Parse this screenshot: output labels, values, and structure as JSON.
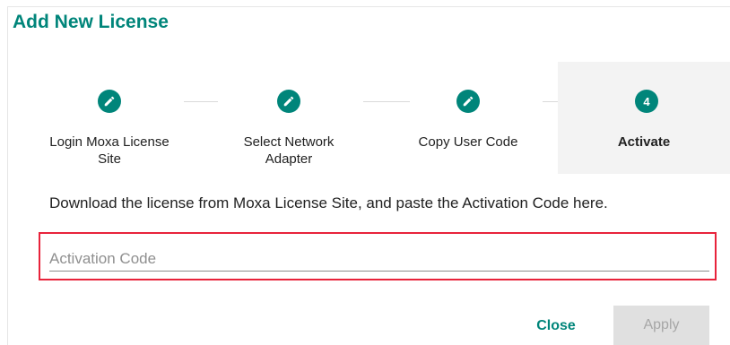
{
  "dialog": {
    "title": "Add New License",
    "instruction": "Download the license from Moxa License Site, and paste the Activation Code here.",
    "activation_field": {
      "placeholder": "Activation Code",
      "value": ""
    },
    "buttons": {
      "close": "Close",
      "apply": "Apply"
    }
  },
  "steps": [
    {
      "label_line1": "Login Moxa License",
      "label_line2": "Site",
      "state": "done",
      "icon": "pencil-icon"
    },
    {
      "label_line1": "Select Network",
      "label_line2": "Adapter",
      "state": "done",
      "icon": "pencil-icon"
    },
    {
      "label_line1": "Copy User Code",
      "label_line2": "",
      "state": "done",
      "icon": "pencil-icon"
    },
    {
      "label_line1": "Activate",
      "label_line2": "",
      "state": "active",
      "number": "4"
    }
  ],
  "colors": {
    "accent": "#00857a",
    "highlight_border": "#e8233b",
    "active_step_bg": "#f3f3f3",
    "disabled_button_bg": "#e0e0e0"
  }
}
